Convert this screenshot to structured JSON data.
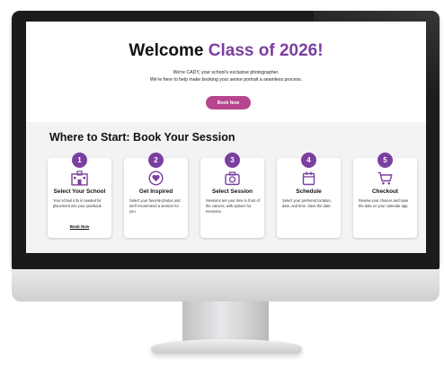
{
  "hero": {
    "title_prefix": "Welcome ",
    "title_accent": "Class of 2026!",
    "subtitle_line1": "We're CADY, your school's exclusive photographer.",
    "subtitle_line2": "We're here to help make booking your senior portrait a seamless process.",
    "button_label": "Book Now"
  },
  "section_title": "Where to Start: Book Your Session",
  "steps": [
    {
      "number": "1",
      "icon": "school-icon",
      "title": "Select Your School",
      "description": "Your school info is needed for placement into your yearbook.",
      "link": "Book Now"
    },
    {
      "number": "2",
      "icon": "heart-icon",
      "title": "Get Inspired",
      "description": "Select your favorite photos and we'll recommend a session for you."
    },
    {
      "number": "3",
      "icon": "camera-icon",
      "title": "Select Session",
      "description": "Sessions are your time in front of the camera, with options for everyone."
    },
    {
      "number": "4",
      "icon": "calendar-icon",
      "title": "Schedule",
      "description": "Select your preferred location, date, and time. Save the date."
    },
    {
      "number": "5",
      "icon": "cart-icon",
      "title": "Checkout",
      "description": "Review your choices and save the date on your calendar app."
    }
  ],
  "colors": {
    "accent_purple": "#7b3fa0",
    "button_pink": "#b8458f",
    "content_background": "#f3f3f5",
    "bezel": "#1b1b1d"
  }
}
